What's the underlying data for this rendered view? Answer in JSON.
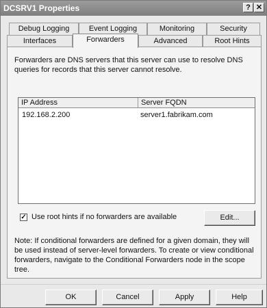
{
  "window": {
    "title": "DCSRV1 Properties",
    "help_glyph": "?",
    "close_glyph": "✕"
  },
  "tabs_row1": [
    "Debug Logging",
    "Event Logging",
    "Monitoring",
    "Security"
  ],
  "tabs_row2": [
    "Interfaces",
    "Forwarders",
    "Advanced",
    "Root Hints"
  ],
  "active_tab": "Forwarders",
  "forwarders": {
    "description": "Forwarders are DNS servers that this server can use to resolve DNS queries for records that this server cannot resolve.",
    "columns": [
      "IP Address",
      "Server FQDN"
    ],
    "rows": [
      {
        "ip": "192.168.2.200",
        "fqdn": "server1.fabrikam.com"
      }
    ],
    "use_root_hints_label": "Use root hints if no forwarders are available",
    "use_root_hints_checked": true,
    "checkmark": "✓",
    "edit_label": "Edit...",
    "note": "Note: If conditional forwarders are defined for a given domain, they will be used instead of server-level forwarders.  To create or view conditional forwarders, navigate to the Conditional Forwarders node in the scope tree."
  },
  "buttons": {
    "ok": "OK",
    "cancel": "Cancel",
    "apply": "Apply",
    "help": "Help"
  }
}
